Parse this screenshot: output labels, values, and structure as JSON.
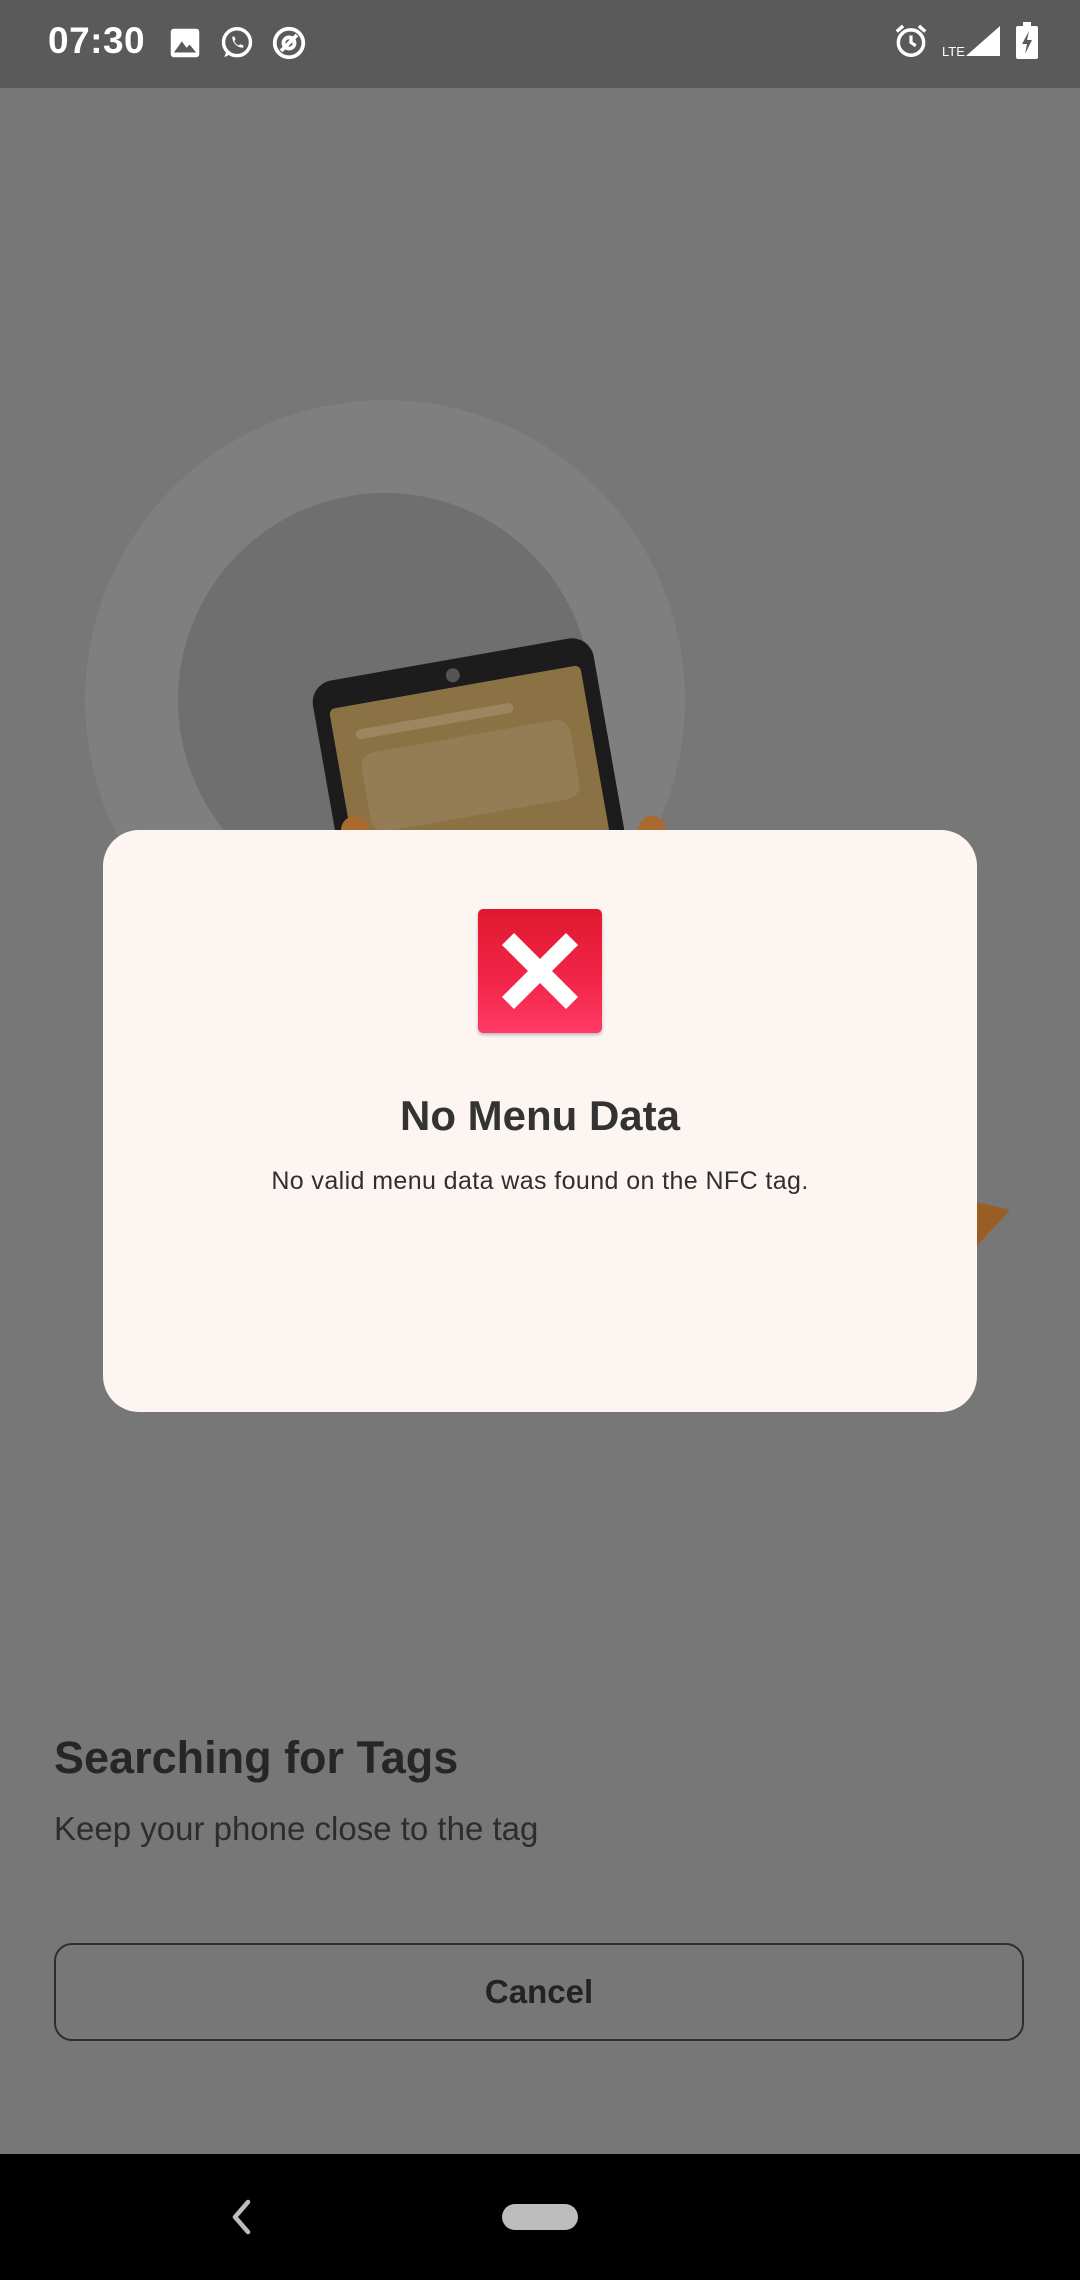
{
  "status_bar": {
    "time": "07:30",
    "left_icons": [
      "image-icon",
      "whatsapp-icon",
      "at-sign-icon"
    ],
    "right_icons": [
      "alarm-icon",
      "lte-signal-icon",
      "battery-charging-icon"
    ],
    "network_label": "LTE"
  },
  "illustration": {
    "icons": [
      "phone-illustration",
      "hand-illustration"
    ],
    "colors": {
      "outer_circle": "#7f7f7f",
      "inner_circle": "#6f6f6f",
      "phone_body": "#1c1c1c",
      "phone_screen": "#8a7245",
      "hand": "#a86a2e"
    }
  },
  "main": {
    "title": "Searching for Tags",
    "subtitle": "Keep your phone close to the tag",
    "cancel_label": "Cancel"
  },
  "dialog": {
    "icon": "error-x-icon",
    "title": "No Menu Data",
    "message": "No valid menu data was found on the NFC tag.",
    "colors": {
      "background": "#fdf5f2",
      "icon": "#f02040"
    }
  },
  "nav_bar": {
    "icons": [
      "back-icon",
      "home-pill-icon"
    ]
  }
}
